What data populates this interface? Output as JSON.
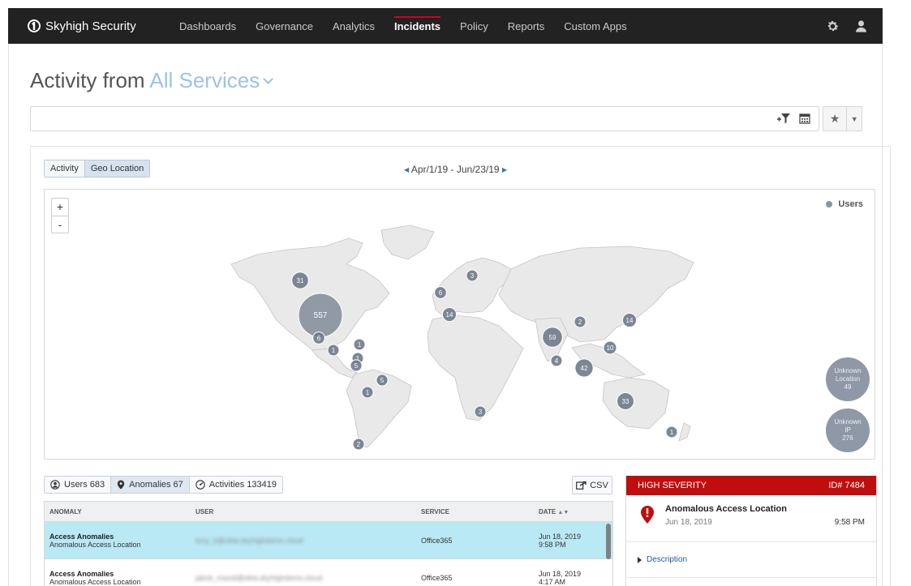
{
  "nav": {
    "brand": "Skyhigh Security",
    "items": [
      {
        "label": "Dashboards",
        "active": false
      },
      {
        "label": "Governance",
        "active": false
      },
      {
        "label": "Analytics",
        "active": false
      },
      {
        "label": "Incidents",
        "active": true
      },
      {
        "label": "Policy",
        "active": false
      },
      {
        "label": "Reports",
        "active": false
      },
      {
        "label": "Custom Apps",
        "active": false
      }
    ],
    "icons": [
      "gear-icon",
      "user-icon"
    ]
  },
  "page": {
    "title_prefix": "Activity from",
    "service_selector": "All Services"
  },
  "filter": {
    "value": "",
    "placeholder": ""
  },
  "view_toggle": {
    "options": [
      "Activity",
      "Geo Location"
    ],
    "selected": "Geo Location"
  },
  "date_range": "Apr/1/19 - Jun/23/19",
  "map": {
    "legend_label": "Users",
    "legend_color": "#8c95a0",
    "zoom_in": "+",
    "zoom_out": "-",
    "unknown_location": {
      "label_lines": [
        "Unknown",
        "Location"
      ],
      "count": "49"
    },
    "unknown_ip": {
      "label_lines": [
        "Unknown",
        "IP"
      ],
      "count": "276"
    },
    "clusters": [
      {
        "count": "557",
        "region": "United States"
      },
      {
        "count": "31",
        "region": "Canada West"
      },
      {
        "count": "6",
        "region": "US South"
      },
      {
        "count": "1",
        "region": "Mexico"
      },
      {
        "count": "1",
        "region": "Central America"
      },
      {
        "count": "1",
        "region": "Caribbean"
      },
      {
        "count": "5",
        "region": "Colombia"
      },
      {
        "count": "5",
        "region": "Brazil"
      },
      {
        "count": "1",
        "region": "Peru"
      },
      {
        "count": "2",
        "region": "Argentina"
      },
      {
        "count": "3",
        "region": "South Africa"
      },
      {
        "count": "6",
        "region": "United Kingdom"
      },
      {
        "count": "3",
        "region": "Scandinavia"
      },
      {
        "count": "14",
        "region": "Spain"
      },
      {
        "count": "59",
        "region": "India"
      },
      {
        "count": "4",
        "region": "Sri Lanka"
      },
      {
        "count": "2",
        "region": "China"
      },
      {
        "count": "14",
        "region": "Japan"
      },
      {
        "count": "42",
        "region": "Indonesia"
      },
      {
        "count": "10",
        "region": "Philippines"
      },
      {
        "count": "33",
        "region": "Australia"
      },
      {
        "count": "1",
        "region": "New Zealand"
      }
    ]
  },
  "tabs": [
    {
      "label": "Users 683",
      "icon": "user-circle-icon",
      "active": false
    },
    {
      "label": "Anomalies 67",
      "icon": "map-pin-icon",
      "active": true
    },
    {
      "label": "Activities 133419",
      "icon": "gauge-icon",
      "active": false
    }
  ],
  "csv_label": "CSV",
  "table": {
    "columns": [
      "ANOMALY",
      "USER",
      "SERVICE",
      "DATE"
    ],
    "rows": [
      {
        "title": "Access Anomalies",
        "subtitle": "Anomalous Access Location",
        "user": "tony_b@okta.skyhighdemo.cloud",
        "service": "Office365",
        "date": "Jun 18, 2019",
        "time": "9:58 PM",
        "selected": true
      },
      {
        "title": "Access Anomalies",
        "subtitle": "Anomalous Access Location",
        "user": "jakob_mazal@okta.skyhighdemo.cloud",
        "service": "Office365",
        "date": "Jun 18, 2019",
        "time": "4:17 AM",
        "selected": false
      }
    ]
  },
  "detail": {
    "severity": "HIGH SEVERITY",
    "id": "ID# 7484",
    "severity_color": "#c00d0d",
    "title": "Anomalous Access Location",
    "date": "Jun 18, 2019",
    "time": "9:58 PM",
    "description_label": "Description"
  }
}
